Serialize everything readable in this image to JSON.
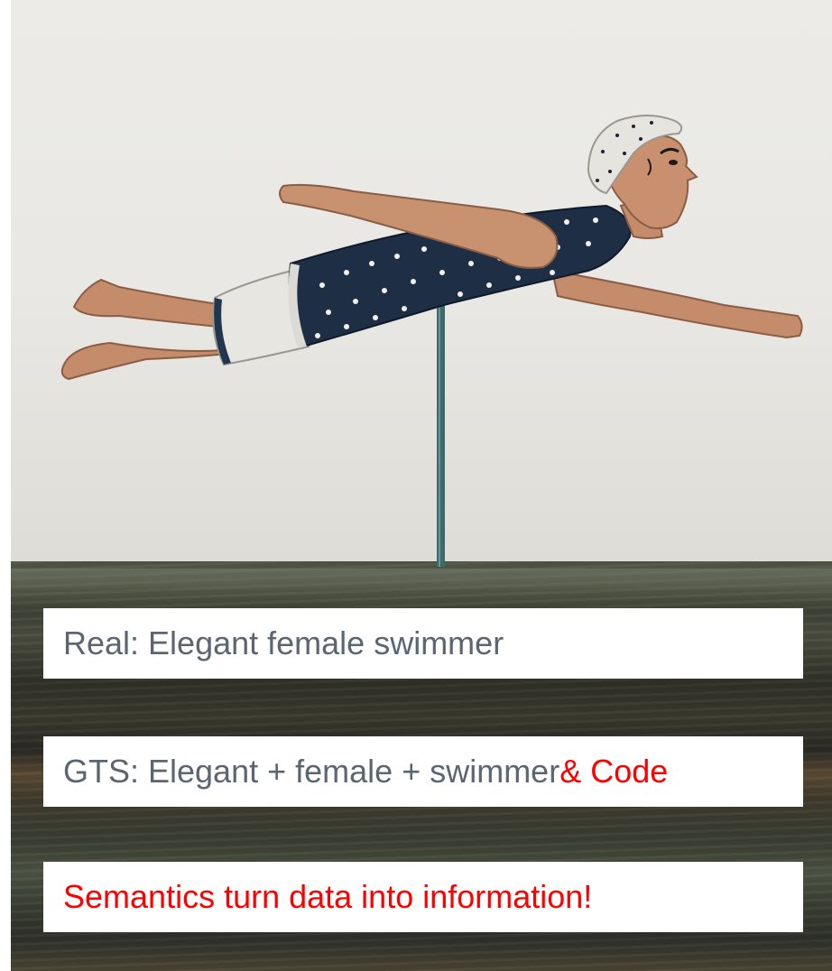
{
  "photo": {
    "subject": "swimmer-figurine",
    "background_color": "#eae9e5",
    "swimsuit_color": "#1e2f45",
    "skin_color": "#c9906f",
    "accent_color": "#ff0000"
  },
  "captions": {
    "real": "Real: Elegant female swimmer",
    "gts_prefix": "GTS: Elegant + female + swimmer",
    "gts_suffix": " & Code",
    "semantics": "Semantics turn data into information!"
  }
}
